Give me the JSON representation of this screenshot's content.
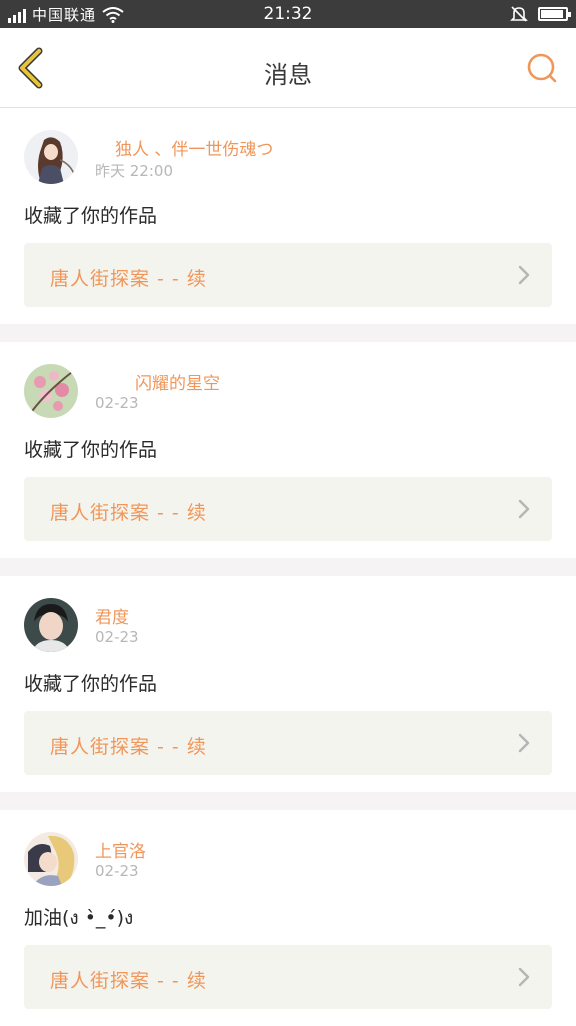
{
  "status_bar": {
    "carrier": "中国联通",
    "time": "21:32",
    "icons": [
      "signal-icon",
      "wifi-icon",
      "mute-icon",
      "battery-icon"
    ]
  },
  "header": {
    "title": "消息",
    "back_icon": "chevron-left-icon",
    "search_icon": "search-icon"
  },
  "colors": {
    "accent": "#f0965a",
    "back_arrow": "#e8c43a",
    "card_link_bg": "#f4f4ee",
    "separator": "#f5f3f3"
  },
  "messages": [
    {
      "username": "独人 、伴一世伤魂つ",
      "time": "昨天 22:00",
      "text": "收藏了你的作品",
      "work_title": "唐人街探案 - - 续"
    },
    {
      "username": "闪耀的星空",
      "time": "02-23",
      "text": "收藏了你的作品",
      "work_title": "唐人街探案 - - 续"
    },
    {
      "username": "君度",
      "time": "02-23",
      "text": "收藏了你的作品",
      "work_title": "唐人街探案 - - 续"
    },
    {
      "username": "上官洛",
      "time": "02-23",
      "text": "加油(ง •̀_•́)ง",
      "work_title": "唐人街探案 - - 续"
    }
  ]
}
